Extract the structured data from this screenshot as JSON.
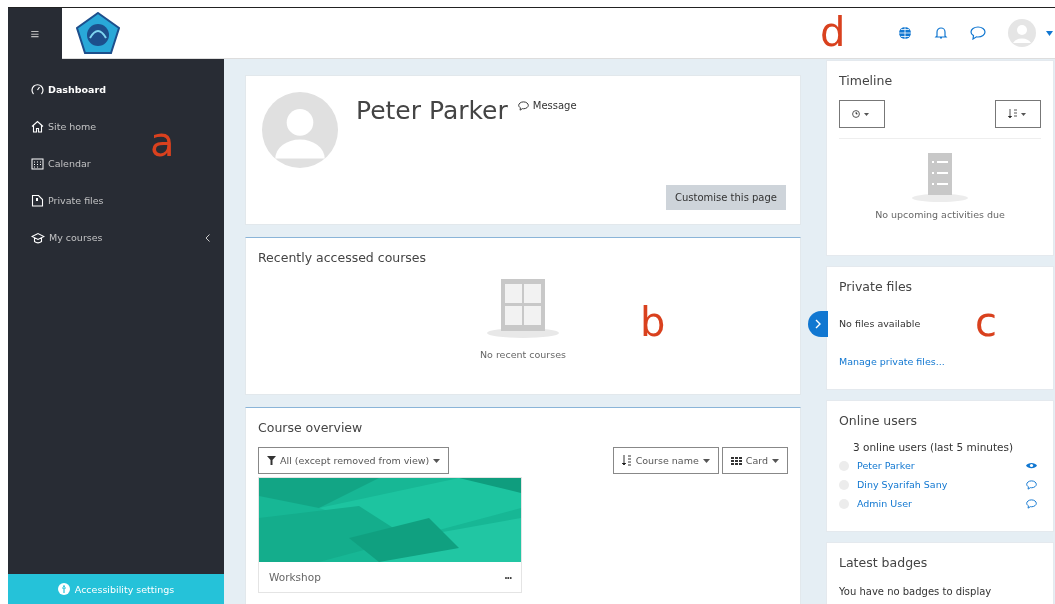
{
  "annotations": [
    {
      "label": "a"
    },
    {
      "label": "b"
    },
    {
      "label": "c"
    },
    {
      "label": "d"
    }
  ],
  "navbar": {
    "menu_glyph": "≡"
  },
  "sidebar": {
    "items": [
      {
        "label": "Dashboard",
        "selected": true,
        "kind": "dashboard"
      },
      {
        "label": "Site home",
        "selected": false,
        "kind": "home"
      },
      {
        "label": "Calendar",
        "selected": false,
        "kind": "calendar"
      },
      {
        "label": "Private files",
        "selected": false,
        "kind": "files"
      },
      {
        "label": "My courses",
        "selected": false,
        "kind": "courses",
        "expandable": true
      }
    ],
    "footer": "Accessibility settings"
  },
  "profile": {
    "name": "Peter Parker",
    "message": "Message",
    "customise_button": "Customise this page"
  },
  "recent_courses": {
    "title": "Recently accessed courses",
    "empty_text": "No recent courses"
  },
  "course_overview": {
    "title": "Course overview",
    "filter": "All (except removed from view)",
    "sort": "Course name",
    "view": "Card",
    "courses": [
      {
        "category": "Workshop",
        "menu": "•••",
        "kind": "picture"
      }
    ]
  },
  "timeline": {
    "title": "Timeline",
    "empty_text": "No upcoming activities due"
  },
  "private_files": {
    "title": "Private files",
    "empty_text": "No files available",
    "link": "Manage private files..."
  },
  "online_users": {
    "title": "Online users",
    "summary": "3 online users (last 5 minutes)",
    "users": [
      {
        "name": "Peter Parker",
        "kind": "self"
      },
      {
        "name": "Diny Syarifah Sany",
        "kind": "other"
      },
      {
        "name": "Admin User",
        "kind": "other"
      }
    ]
  },
  "latest_badges": {
    "title": "Latest badges",
    "empty_text": "You have no badges to display"
  }
}
